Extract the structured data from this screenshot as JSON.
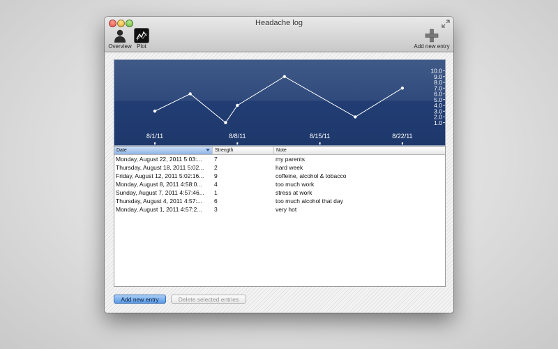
{
  "window": {
    "title": "Headache log"
  },
  "toolbar": {
    "overview_label": "Overview",
    "plot_label": "Plot",
    "add_label": "Add new entry",
    "icons": {
      "overview": "person-silhouette-icon",
      "plot": "line-graph-icon",
      "add": "plus-icon"
    }
  },
  "chart_data": {
    "type": "line",
    "x": [
      "2011-08-01",
      "2011-08-04",
      "2011-08-07",
      "2011-08-08",
      "2011-08-12",
      "2011-08-18",
      "2011-08-22"
    ],
    "values": [
      3,
      6,
      1,
      4,
      9,
      2,
      7
    ],
    "xticks": [
      "8/1/11",
      "8/8/11",
      "8/15/11",
      "8/22/11"
    ],
    "yticks": [
      "10.0",
      "9.0",
      "8.0",
      "7.0",
      "6.0",
      "5.0",
      "4.0",
      "3.0",
      "2.0",
      "1.0"
    ],
    "ylim": [
      0,
      10
    ],
    "grid": false,
    "colors": {
      "line": "#ffffff",
      "background_top": "#405a87",
      "background_bottom": "#1e386b"
    }
  },
  "table": {
    "columns": {
      "date": "Date",
      "strength": "Strength",
      "note": "Note"
    },
    "rows": [
      {
        "date": "Monday, August 22, 2011 5:03:...",
        "strength": "7",
        "note": "my parents"
      },
      {
        "date": "Thursday, August 18, 2011 5:02...",
        "strength": "2",
        "note": "hard week"
      },
      {
        "date": "Friday, August 12, 2011 5:02:16...",
        "strength": "9",
        "note": "coffeine, alcohol & tobacco"
      },
      {
        "date": "Monday, August 8, 2011 4:58:0...",
        "strength": "4",
        "note": "too much work"
      },
      {
        "date": "Sunday, August 7, 2011 4:57:46...",
        "strength": "1",
        "note": "stress at work"
      },
      {
        "date": "Thursday, August 4, 2011 4:57:...",
        "strength": "6",
        "note": "too much alcohol that day"
      },
      {
        "date": "Monday, August 1, 2011 4:57:2...",
        "strength": "3",
        "note": "very hot"
      }
    ]
  },
  "buttons": {
    "add_label": "Add new entry",
    "delete_label": "Delete selected entries"
  },
  "colors": {
    "accent": "#5b9be5",
    "chart_bg": "#2f4a7c"
  }
}
